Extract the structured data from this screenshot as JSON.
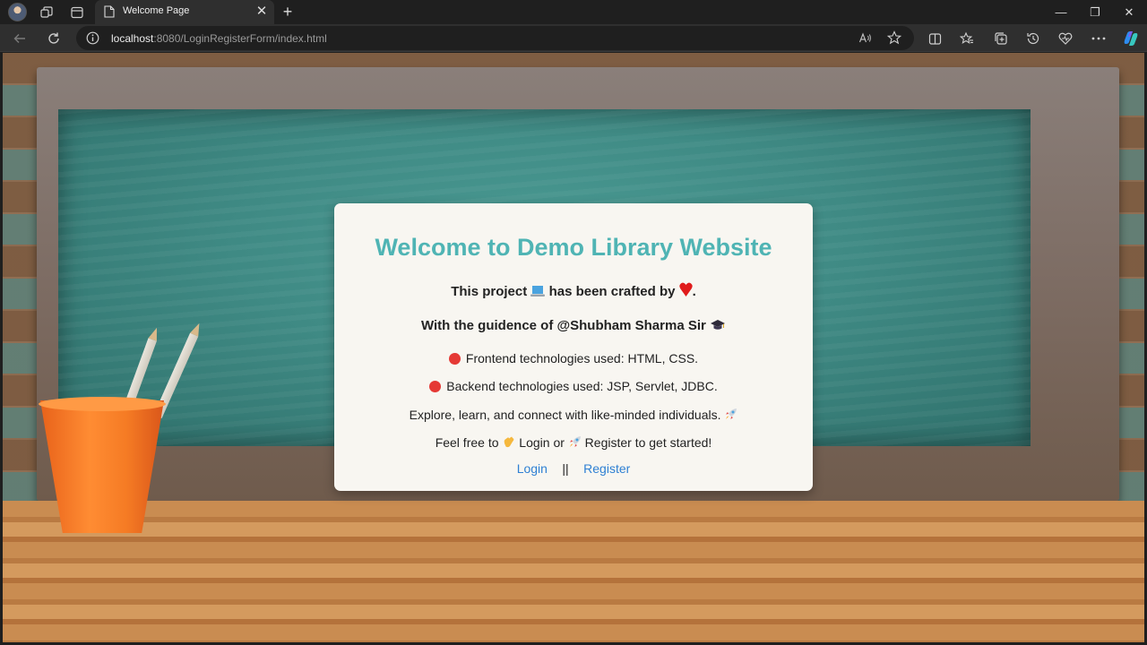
{
  "browser": {
    "tab_title": "Welcome Page",
    "tab_close": "✕",
    "new_tab": "+",
    "url_host": "localhost",
    "url_rest": ":8080/LoginRegisterForm/index.html",
    "window_controls": {
      "minimize": "—",
      "maximize": "❐",
      "close": "✕"
    }
  },
  "card": {
    "title": "Welcome to Demo Library Website",
    "crafted_prefix": "This project",
    "crafted_middle": "has been crafted by",
    "crafted_suffix": ".",
    "guidance": "With the guidence of @Shubham Sharma Sir",
    "frontend": "Frontend technologies used: HTML, CSS.",
    "backend": "Backend technologies used: JSP, Servlet, JDBC.",
    "explore": "Explore, learn, and connect with like-minded individuals.",
    "feel_prefix": "Feel free to",
    "feel_login": "Login or",
    "feel_register": "Register to get started!",
    "link_login": "Login",
    "link_separator": "||",
    "link_register": "Register"
  },
  "colors": {
    "title": "#4fb4b4",
    "link": "#2f80d3",
    "bullet": "#e53935",
    "heart": "#e01b1b"
  }
}
